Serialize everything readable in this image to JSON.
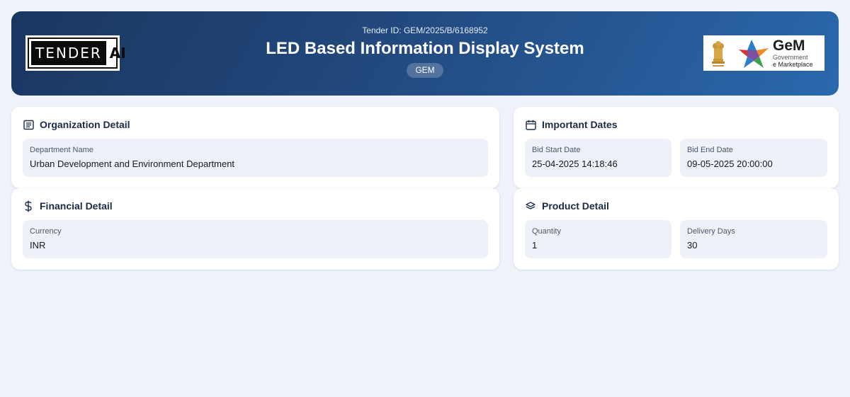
{
  "header": {
    "logo_left": {
      "word": "TENDER",
      "suffix": "AI"
    },
    "tender_id": "Tender ID: GEM/2025/B/6168952",
    "title": "LED Based Information Display System",
    "badge": "GEM",
    "logo_right": {
      "name": "GeM",
      "line1": "Government",
      "line2": "e Marketplace"
    }
  },
  "organization": {
    "title": "Organization Detail",
    "icon": "document-list-icon",
    "department_label": "Department Name",
    "department_value": "Urban Development and Environment Department"
  },
  "dates": {
    "title": "Important Dates",
    "icon": "calendar-icon",
    "start_label": "Bid Start Date",
    "start_value": "25-04-2025 14:18:46",
    "end_label": "Bid End Date",
    "end_value": "09-05-2025 20:00:00"
  },
  "financial": {
    "title": "Financial Detail",
    "icon": "dollar-icon",
    "currency_label": "Currency",
    "currency_value": "INR"
  },
  "product": {
    "title": "Product Detail",
    "icon": "layers-icon",
    "quantity_label": "Quantity",
    "quantity_value": "1",
    "delivery_label": "Delivery Days",
    "delivery_value": "30"
  },
  "colors": {
    "header_gradient_start": "#1a3660",
    "header_gradient_end": "#2a68ad",
    "page_background": "#eff3f9",
    "field_background": "#eef2f8",
    "title_text": "#1c2b45"
  }
}
